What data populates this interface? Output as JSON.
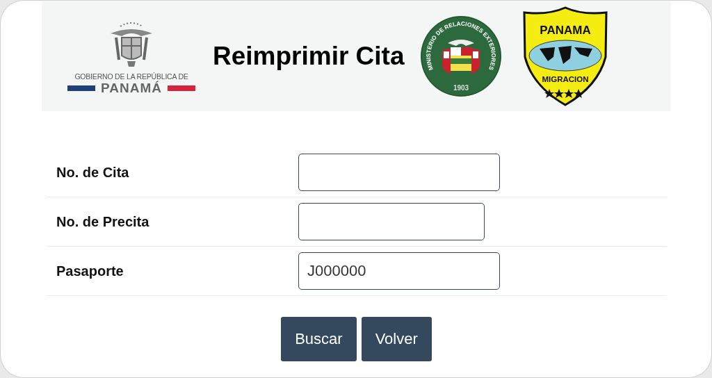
{
  "header": {
    "title": "Reimprimir Cita",
    "logos": [
      {
        "kind": "government",
        "line1": "GOBIERNO DE LA REPÚBLICA DE",
        "line2": "PANAMÁ"
      },
      {
        "kind": "seal",
        "ring": "MINISTERIO DE RELACIONES EXTERIORES",
        "year": "1903"
      },
      {
        "kind": "shield",
        "top": "PANAMA",
        "bottom": "MIGRACION"
      }
    ]
  },
  "fields": [
    {
      "label": "No. de Cita",
      "kind": "long"
    },
    {
      "label": "No. de Precita",
      "kind": "short"
    },
    {
      "label": "Pasaporte",
      "kind": "long",
      "value": "J000000"
    }
  ],
  "buttons": [
    "Buscar",
    "Volver"
  ]
}
